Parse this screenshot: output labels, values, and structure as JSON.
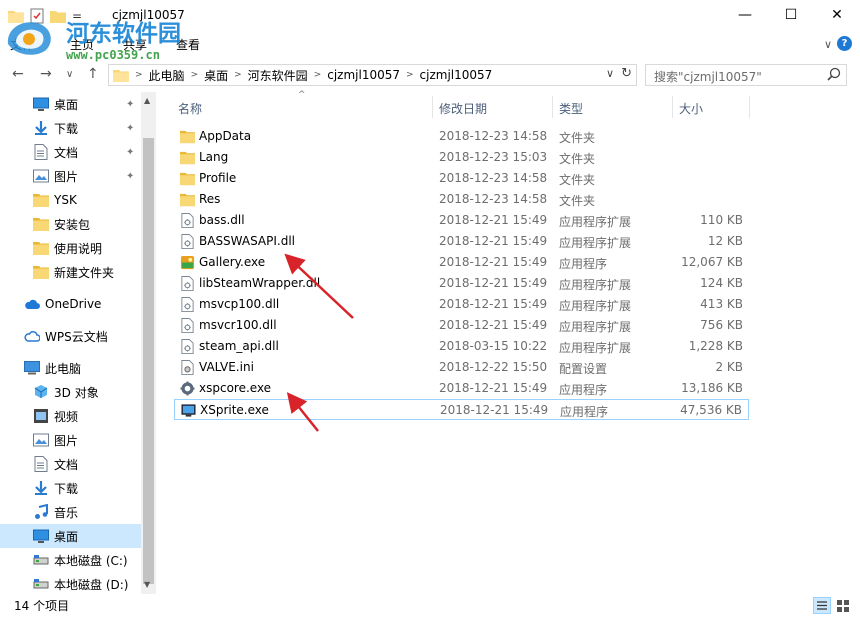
{
  "window": {
    "title": "cjzmjl10057",
    "quick_access_glyph": "=",
    "min_glyph": "—",
    "max_glyph": "☐",
    "close_glyph": "✕"
  },
  "ribbon": {
    "tabs": [
      "文件",
      "主页",
      "共享",
      "查看"
    ],
    "expand_glyph": "∨",
    "help_glyph": "?"
  },
  "watermark": {
    "text": "河东软件园",
    "url": "www.pc0359.cn"
  },
  "nav": {
    "back": "←",
    "forward": "→",
    "recent": "∨",
    "up": "↑"
  },
  "address": {
    "breadcrumbs": [
      "此电脑",
      "桌面",
      "河东软件园",
      "cjzmjl10057",
      "cjzmjl10057"
    ],
    "sep": ">",
    "dropdown": "∨",
    "refresh": "↻"
  },
  "search": {
    "placeholder": "搜索\"cjzmjl10057\""
  },
  "navpane": {
    "items": [
      {
        "label": "桌面",
        "icon": "desktop-icon",
        "pinned": true
      },
      {
        "label": "下载",
        "icon": "download-icon",
        "pinned": true
      },
      {
        "label": "文档",
        "icon": "document-icon",
        "pinned": true
      },
      {
        "label": "图片",
        "icon": "picture-icon",
        "pinned": true
      },
      {
        "label": "YSK",
        "icon": "folder-icon",
        "pinned": false
      },
      {
        "label": "安装包",
        "icon": "folder-icon",
        "pinned": false
      },
      {
        "label": "使用说明",
        "icon": "folder-icon",
        "pinned": false
      },
      {
        "label": "新建文件夹",
        "icon": "folder-icon",
        "pinned": false
      },
      {
        "label": "OneDrive",
        "icon": "cloud-icon",
        "pinned": false
      },
      {
        "label": "WPS云文档",
        "icon": "wps-cloud-icon",
        "pinned": false
      },
      {
        "label": "此电脑",
        "icon": "computer-icon",
        "pinned": false
      },
      {
        "label": "3D 对象",
        "icon": "3d-objects-icon",
        "pinned": false
      },
      {
        "label": "视频",
        "icon": "video-icon",
        "pinned": false
      },
      {
        "label": "图片",
        "icon": "picture-icon",
        "pinned": false
      },
      {
        "label": "文档",
        "icon": "document-icon",
        "pinned": false
      },
      {
        "label": "下载",
        "icon": "download-icon",
        "pinned": false
      },
      {
        "label": "音乐",
        "icon": "music-icon",
        "pinned": false
      },
      {
        "label": "桌面",
        "icon": "desktop-icon",
        "pinned": false,
        "selected": true
      },
      {
        "label": "本地磁盘 (C:)",
        "icon": "drive-icon",
        "pinned": false
      },
      {
        "label": "本地磁盘 (D:)",
        "icon": "drive-icon",
        "pinned": false
      }
    ],
    "pin_glyph": "📌"
  },
  "columns": {
    "name": "名称",
    "date": "修改日期",
    "type": "类型",
    "size": "大小",
    "sort_glyph": "^"
  },
  "files": [
    {
      "name": "AppData",
      "date": "2018-12-23 14:58",
      "type": "文件夹",
      "size": "",
      "icon": "folder-icon"
    },
    {
      "name": "Lang",
      "date": "2018-12-23 15:03",
      "type": "文件夹",
      "size": "",
      "icon": "folder-icon"
    },
    {
      "name": "Profile",
      "date": "2018-12-23 14:58",
      "type": "文件夹",
      "size": "",
      "icon": "folder-icon"
    },
    {
      "name": "Res",
      "date": "2018-12-23 14:58",
      "type": "文件夹",
      "size": "",
      "icon": "folder-icon"
    },
    {
      "name": "bass.dll",
      "date": "2018-12-21 15:49",
      "type": "应用程序扩展",
      "size": "110 KB",
      "icon": "dll-icon"
    },
    {
      "name": "BASSWASAPI.dll",
      "date": "2018-12-21 15:49",
      "type": "应用程序扩展",
      "size": "12 KB",
      "icon": "dll-icon"
    },
    {
      "name": "Gallery.exe",
      "date": "2018-12-21 15:49",
      "type": "应用程序",
      "size": "12,067 KB",
      "icon": "gallery-exe-icon"
    },
    {
      "name": "libSteamWrapper.dll",
      "date": "2018-12-21 15:49",
      "type": "应用程序扩展",
      "size": "124 KB",
      "icon": "dll-icon"
    },
    {
      "name": "msvcp100.dll",
      "date": "2018-12-21 15:49",
      "type": "应用程序扩展",
      "size": "413 KB",
      "icon": "dll-icon"
    },
    {
      "name": "msvcr100.dll",
      "date": "2018-12-21 15:49",
      "type": "应用程序扩展",
      "size": "756 KB",
      "icon": "dll-icon"
    },
    {
      "name": "steam_api.dll",
      "date": "2018-03-15 10:22",
      "type": "应用程序扩展",
      "size": "1,228 KB",
      "icon": "dll-icon"
    },
    {
      "name": "VALVE.ini",
      "date": "2018-12-22 15:50",
      "type": "配置设置",
      "size": "2 KB",
      "icon": "ini-icon"
    },
    {
      "name": "xspcore.exe",
      "date": "2018-12-21 15:49",
      "type": "应用程序",
      "size": "13,186 KB",
      "icon": "gear-exe-icon"
    },
    {
      "name": "XSprite.exe",
      "date": "2018-12-21 15:49",
      "type": "应用程序",
      "size": "47,536 KB",
      "icon": "xsprite-exe-icon",
      "selected": true
    }
  ],
  "status": {
    "count": "14 个项目"
  },
  "colors": {
    "selection": "#cce8ff",
    "selection_border": "#99d1ff",
    "header_text": "#4c607a",
    "folder": "#f8d775",
    "arrow": "#d8232a",
    "watermark_blue": "#1a87d6",
    "watermark_green": "#2f9a3b"
  }
}
